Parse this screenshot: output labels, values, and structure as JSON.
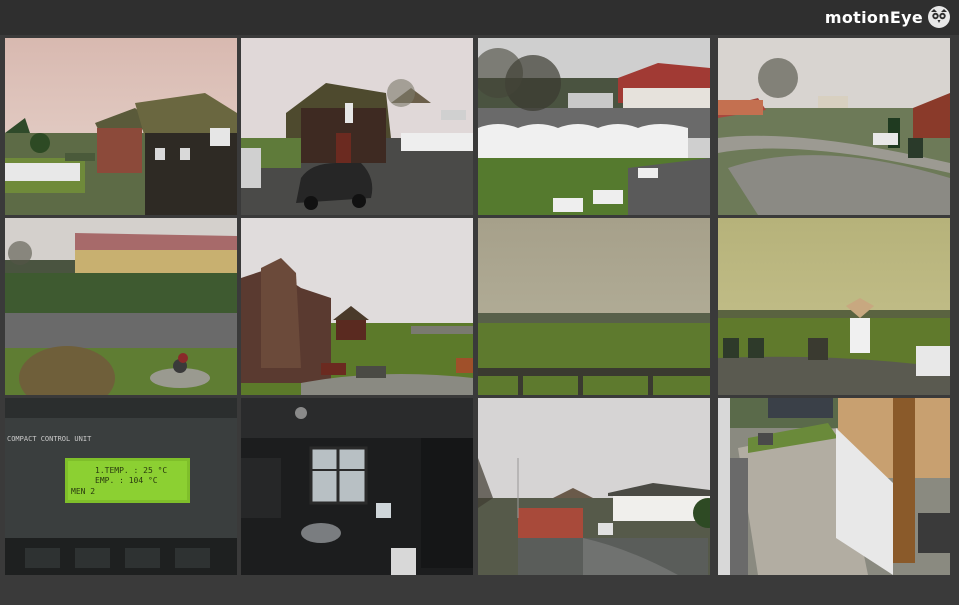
{
  "app": {
    "title": "motionEye",
    "logo_icon": "owl-icon"
  },
  "colors": {
    "header_bg": "#2f2f2f",
    "page_bg": "#3a3a3a",
    "brand_text": "#ffffff"
  },
  "cameras": [
    {
      "scene": "thatched-house-dusk"
    },
    {
      "scene": "barn-and-car"
    },
    {
      "scene": "white-fence-garden"
    },
    {
      "scene": "road-and-houses"
    },
    {
      "scene": "yellow-house-road"
    },
    {
      "scene": "shed-and-lawn"
    },
    {
      "scene": "foggy-field"
    },
    {
      "scene": "windmill-lawn"
    },
    {
      "scene": "control-panel-display"
    },
    {
      "scene": "dark-room-window"
    },
    {
      "scene": "house-overcast"
    },
    {
      "scene": "patio-view"
    }
  ],
  "control_panel": {
    "unit_label": "COMPACT CONTROL UNIT",
    "line1": "1.TEMP.  :  25 °C",
    "line2": "EMP.  :  104 °C",
    "line3": "MEN 2"
  }
}
